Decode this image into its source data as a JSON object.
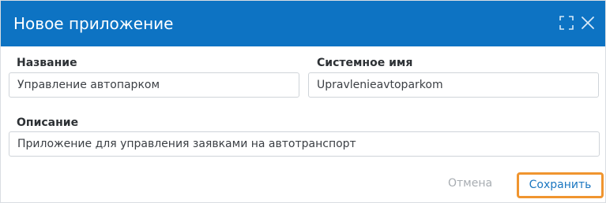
{
  "dialog": {
    "title": "Новое приложение",
    "colors": {
      "header": "#0d73c3",
      "save_highlight": "#f0952f",
      "save_text": "#1a76c0",
      "cancel_text": "#a7acb1"
    },
    "icons": {
      "maximize": "maximize-icon",
      "close": "close-icon"
    }
  },
  "form": {
    "name_label": "Название",
    "name_value": "Управление автопарком",
    "system_name_label": "Системное имя",
    "system_name_value": "Upravlenieavtoparkom",
    "description_label": "Описание",
    "description_value": "Приложение для управления заявками на автотранспорт"
  },
  "actions": {
    "cancel_label": "Отмена",
    "save_label": "Сохранить"
  }
}
